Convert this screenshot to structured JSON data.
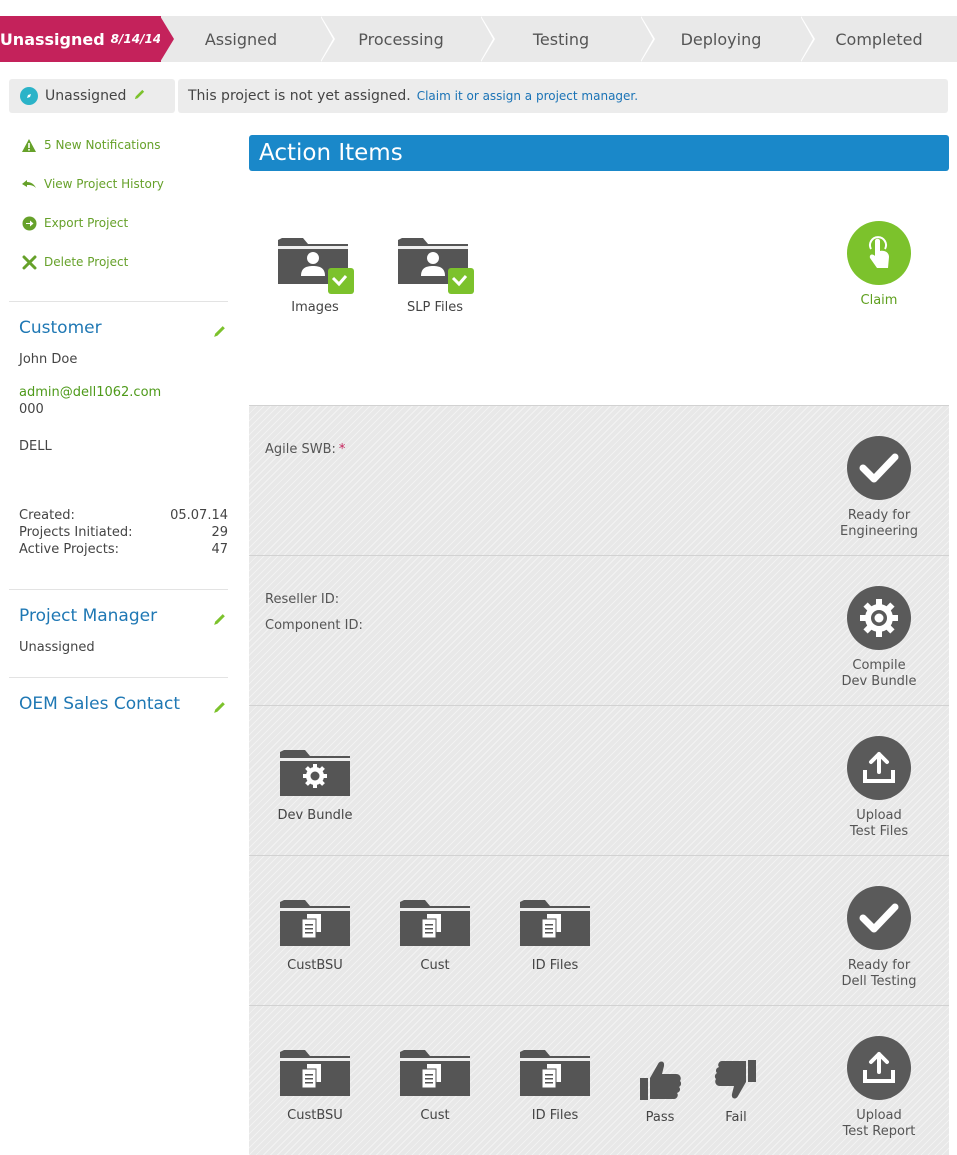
{
  "progress": {
    "steps": [
      {
        "label": "Unassigned",
        "date": "8/14/14"
      },
      {
        "label": "Assigned"
      },
      {
        "label": "Processing"
      },
      {
        "label": "Testing"
      },
      {
        "label": "Deploying"
      },
      {
        "label": "Completed"
      }
    ]
  },
  "status": {
    "label": "Unassigned"
  },
  "notice": {
    "text": "This project is not yet assigned.",
    "link": "Claim it or assign a project manager."
  },
  "sidebar": {
    "actions": [
      {
        "label": "5 New Notifications",
        "icon": "warning-icon"
      },
      {
        "label": "View Project History",
        "icon": "history-icon"
      },
      {
        "label": "Export Project",
        "icon": "export-icon"
      },
      {
        "label": "Delete Project",
        "icon": "delete-icon"
      }
    ],
    "customer": {
      "title": "Customer",
      "name": "John Doe",
      "email": "admin@dell1062.com",
      "phone": "000",
      "company": "DELL",
      "stats": [
        {
          "label": "Created:",
          "value": "05.07.14"
        },
        {
          "label": "Projects Initiated:",
          "value": "29"
        },
        {
          "label": "Active Projects:",
          "value": "47"
        }
      ]
    },
    "project_manager": {
      "title": "Project Manager",
      "value": "Unassigned"
    },
    "oem": {
      "title": "OEM Sales Contact"
    }
  },
  "main": {
    "title": "Action Items",
    "top": {
      "files": [
        "Images",
        "SLP Files"
      ],
      "claim": "Claim"
    },
    "row1": {
      "field": "Agile SWB:",
      "required": "*",
      "button": [
        "Ready for",
        "Engineering"
      ]
    },
    "row2": {
      "fields": [
        "Reseller ID:",
        "Component ID:"
      ],
      "button": [
        "Compile",
        "Dev Bundle"
      ]
    },
    "row3": {
      "file": "Dev Bundle",
      "button": [
        "Upload",
        "Test Files"
      ]
    },
    "row4": {
      "files": [
        "CustBSU",
        "Cust",
        "ID Files"
      ],
      "button": [
        "Ready for",
        "Dell Testing"
      ]
    },
    "row5": {
      "files": [
        "CustBSU",
        "Cust",
        "ID Files"
      ],
      "pass": "Pass",
      "fail": "Fail",
      "button": [
        "Upload",
        "Test Report"
      ]
    }
  },
  "colors": {
    "accent": "#1a88c9",
    "active_step": "#c4225b",
    "green": "#7cc22c"
  }
}
